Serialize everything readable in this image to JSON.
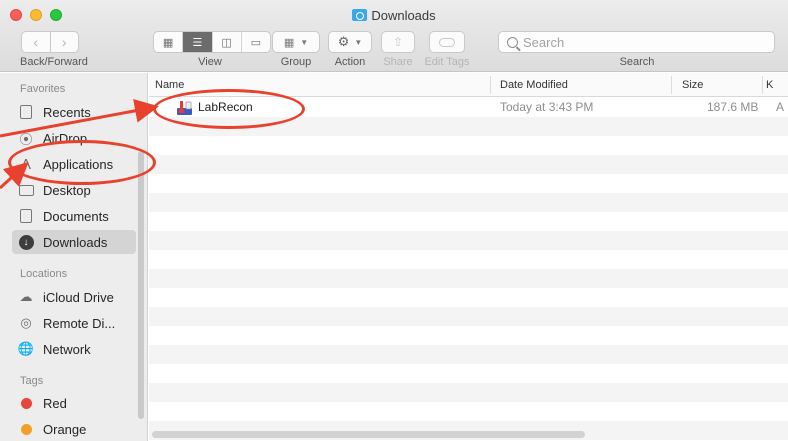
{
  "window": {
    "title": "Downloads"
  },
  "toolbar": {
    "back_forward_label": "Back/Forward",
    "view_label": "View",
    "group_label": "Group",
    "action_label": "Action",
    "share_label": "Share",
    "edit_tags_label": "Edit Tags",
    "search_label": "Search",
    "search_placeholder": "Search"
  },
  "sidebar": {
    "favorites_header": "Favorites",
    "favorites": [
      {
        "label": "Recents",
        "icon": "recents-icon"
      },
      {
        "label": "AirDrop",
        "icon": "airdrop-icon"
      },
      {
        "label": "Applications",
        "icon": "applications-icon"
      },
      {
        "label": "Desktop",
        "icon": "desktop-icon"
      },
      {
        "label": "Documents",
        "icon": "documents-icon"
      },
      {
        "label": "Downloads",
        "icon": "downloads-icon",
        "selected": true
      }
    ],
    "locations_header": "Locations",
    "locations": [
      {
        "label": "iCloud Drive",
        "icon": "icloud-icon"
      },
      {
        "label": "Remote Di...",
        "icon": "remote-disc-icon"
      },
      {
        "label": "Network",
        "icon": "network-icon"
      }
    ],
    "tags_header": "Tags",
    "tags": [
      {
        "label": "Red",
        "color": "#e8463e"
      },
      {
        "label": "Orange",
        "color": "#f3a02a"
      }
    ]
  },
  "columns": {
    "name": "Name",
    "date_modified": "Date Modified",
    "size": "Size",
    "kind_partial": "K"
  },
  "files": [
    {
      "name": "LabRecon",
      "date_modified": "Today at 3:43 PM",
      "size": "187.6 MB",
      "kind_partial": "A"
    }
  ],
  "colors": {
    "annotation": "#e8412d"
  }
}
